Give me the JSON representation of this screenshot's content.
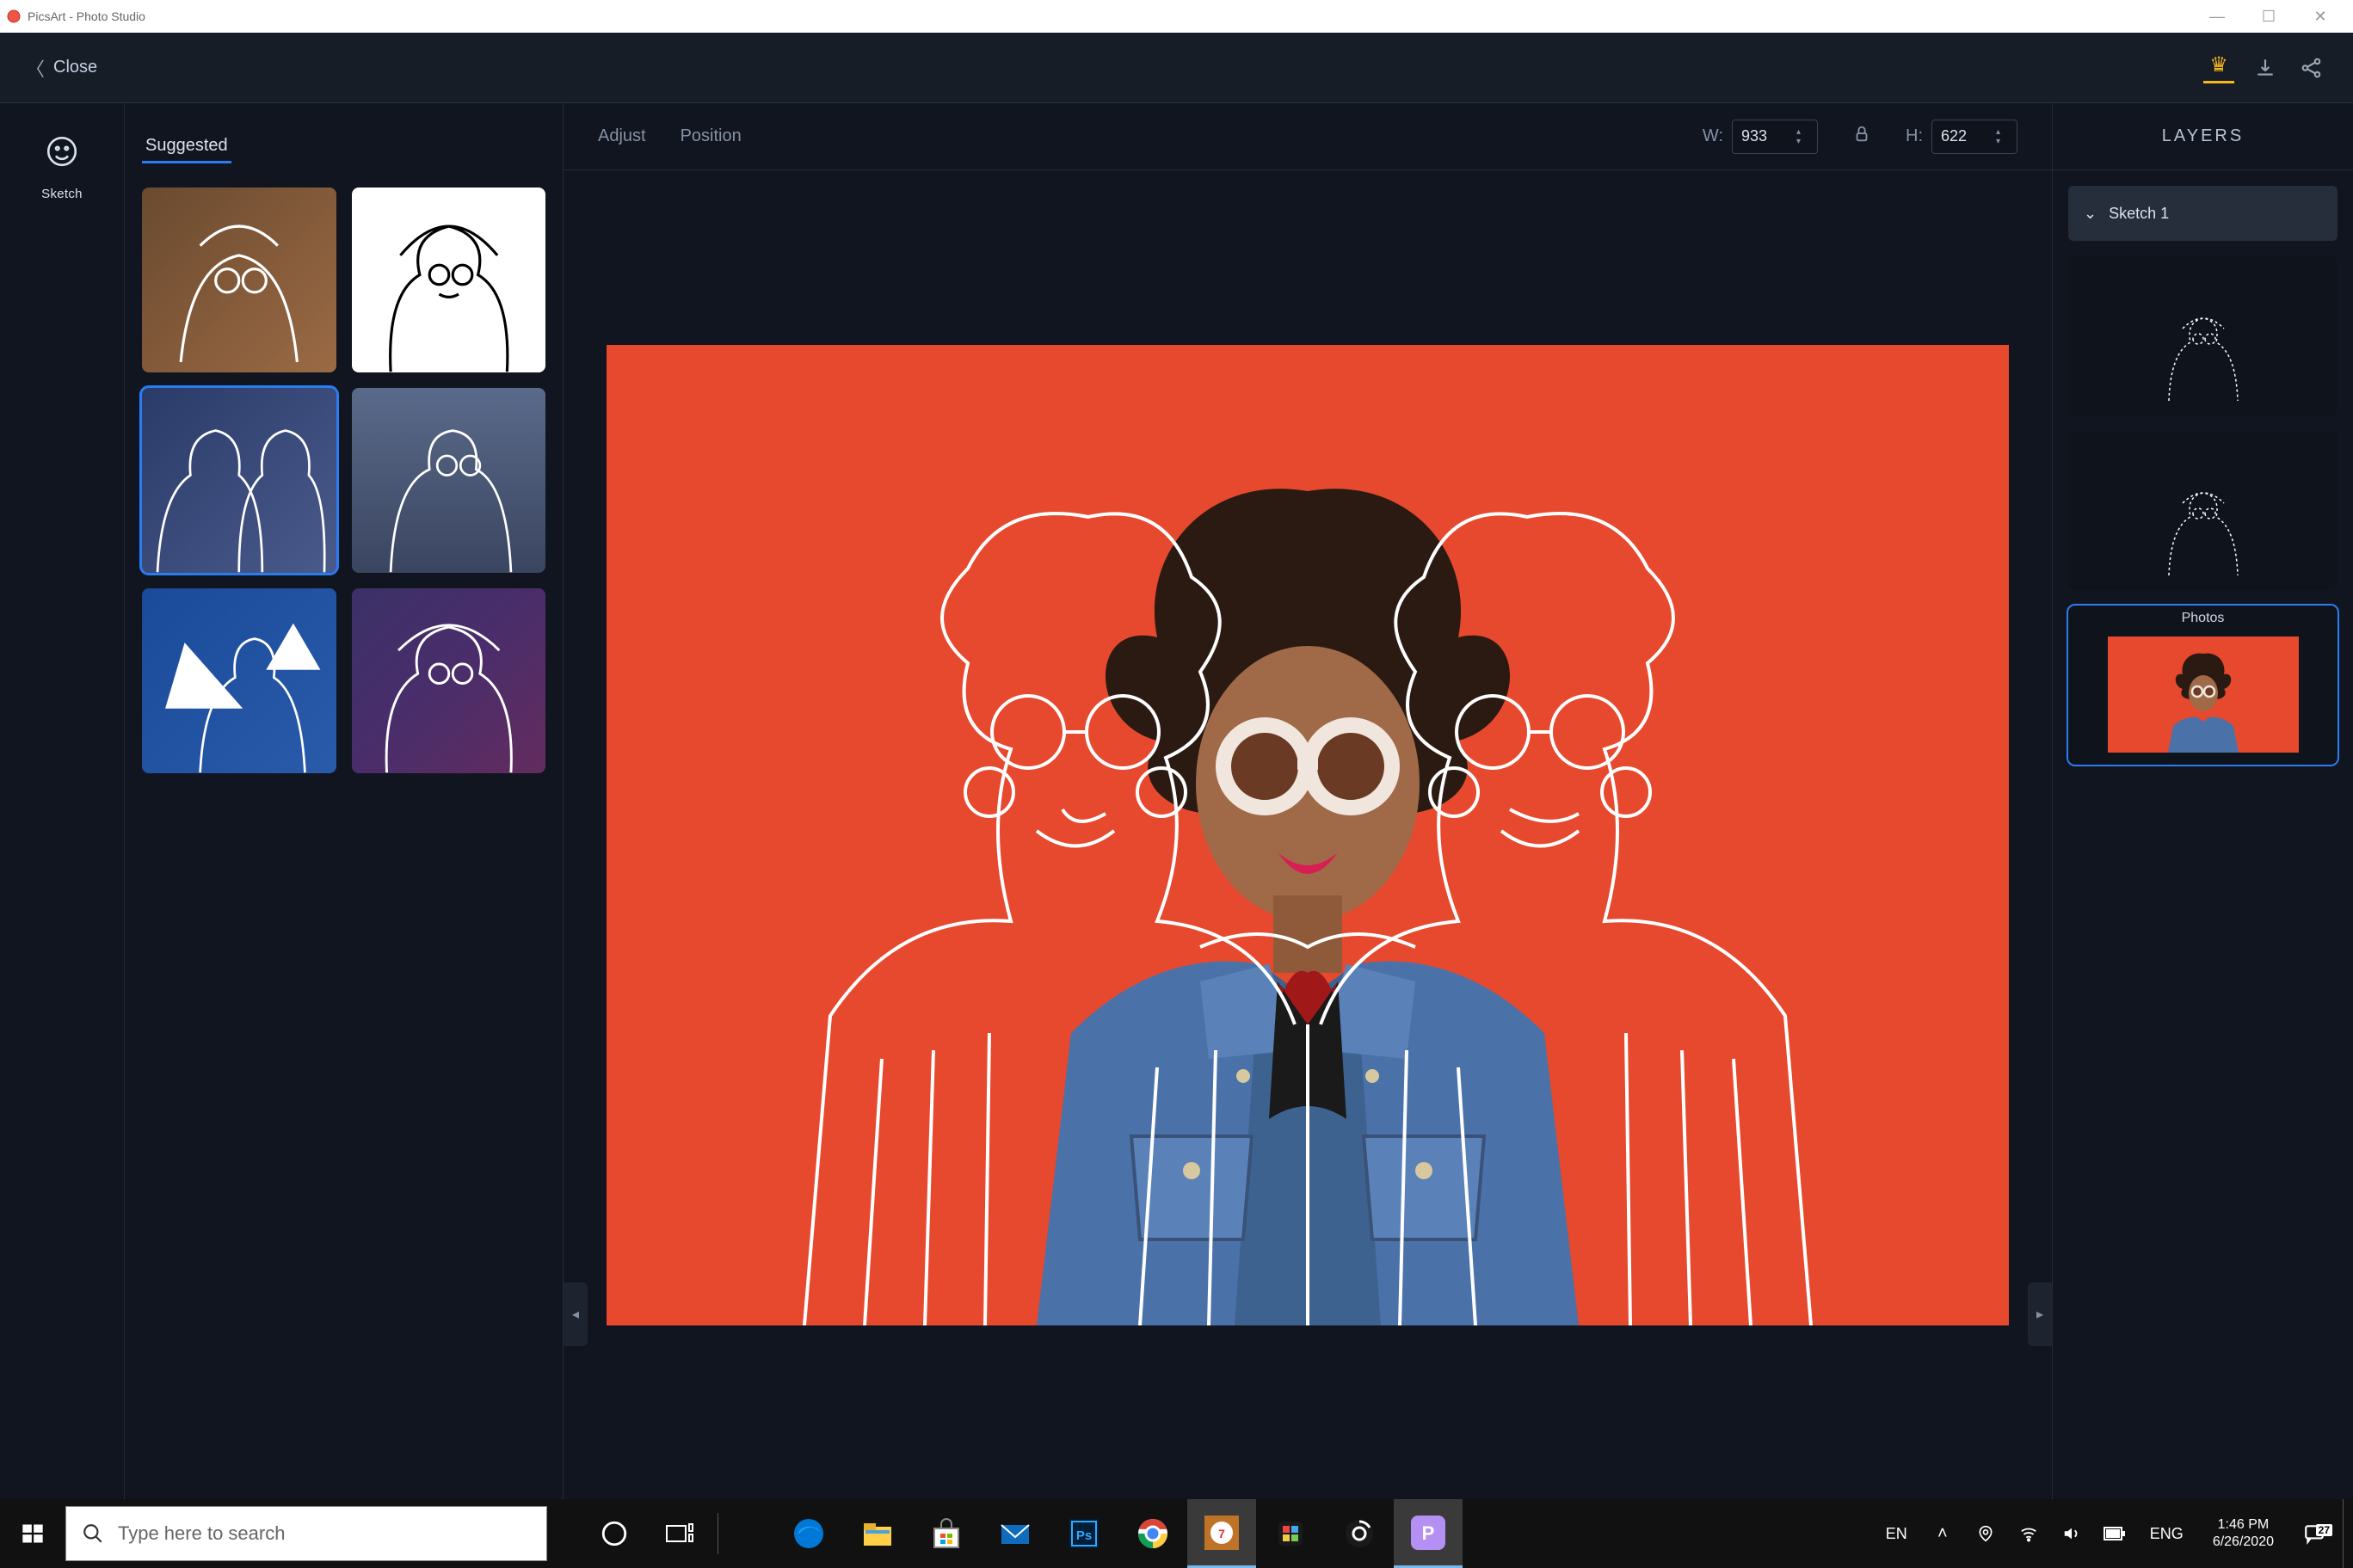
{
  "window": {
    "title": "PicsArt - Photo Studio"
  },
  "topbar": {
    "close": "Close"
  },
  "tool": {
    "label": "Sketch"
  },
  "sidepanel": {
    "tab": "Suggested"
  },
  "canvasHeader": {
    "adjust": "Adjust",
    "position": "Position",
    "wLabel": "W:",
    "hLabel": "H:",
    "width": "933",
    "height": "622"
  },
  "layers": {
    "title": "LAYERS",
    "sketchRow": "Sketch 1",
    "photosLabel": "Photos"
  },
  "taskbar": {
    "searchPlaceholder": "Type here to search",
    "lang1": "EN",
    "lang2": "ENG",
    "time": "1:46 PM",
    "date": "6/26/2020",
    "notifCount": "27"
  }
}
